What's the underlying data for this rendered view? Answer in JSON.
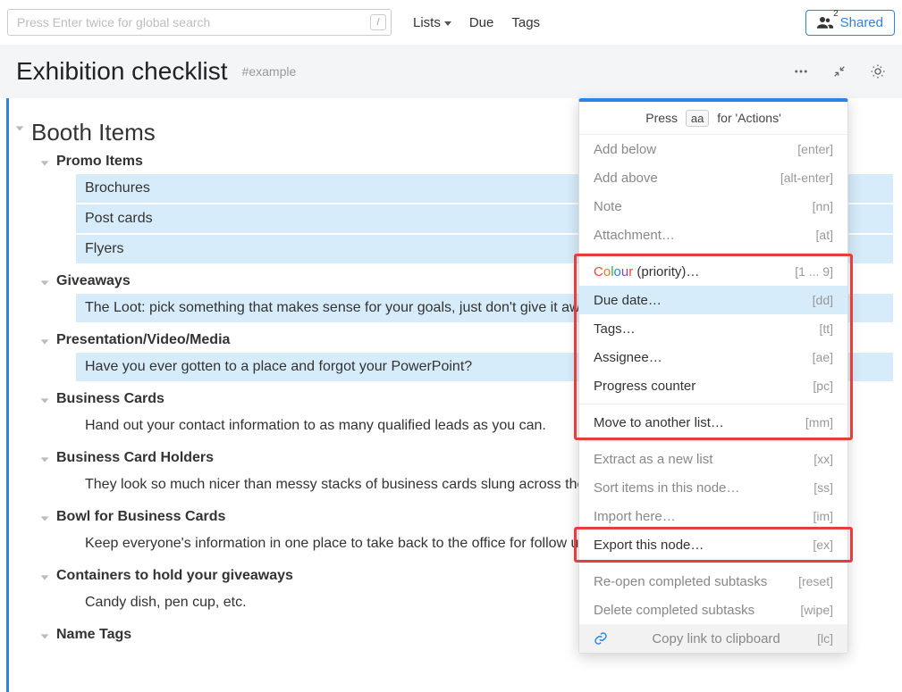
{
  "topbar": {
    "search_placeholder": "Press Enter twice for global search",
    "slash": "/",
    "nav": {
      "lists": "Lists",
      "due": "Due",
      "tags": "Tags"
    },
    "shared": {
      "label": "Shared",
      "count": "2"
    }
  },
  "title": {
    "text": "Exhibition checklist",
    "tag": "#example"
  },
  "outline": {
    "root": "Booth Items",
    "sections": [
      {
        "title": "Promo Items",
        "items": [
          {
            "text": "Brochures",
            "sel": true
          },
          {
            "text": "Post cards",
            "sel": true
          },
          {
            "text": "Flyers",
            "sel": true
          }
        ]
      },
      {
        "title": "Giveaways",
        "items": [
          {
            "text": "The Loot: pick something that makes sense for your goals, just don't give it away for free like candy to trick-or-treaters.",
            "sel": true
          }
        ]
      },
      {
        "title": "Presentation/Video/Media",
        "items": [
          {
            "text": "Have you ever gotten to a place and forgot your PowerPoint?",
            "sel": true
          }
        ]
      },
      {
        "title": "Business Cards",
        "items": [
          {
            "text": "Hand out your contact information to as many qualified leads as you can.",
            "sel": false
          }
        ]
      },
      {
        "title": "Business Card Holders",
        "items": [
          {
            "text": "They look so much nicer than messy stacks of business cards slung across the table.",
            "sel": false
          }
        ]
      },
      {
        "title": "Bowl for Business Cards",
        "items": [
          {
            "text": "Keep everyone's information in one place to take back to the office for follow ups.",
            "sel": false
          }
        ]
      },
      {
        "title": "Containers to hold your giveaways",
        "items": [
          {
            "text": "Candy dish, pen cup, etc.",
            "sel": false
          }
        ]
      },
      {
        "title": "Name Tags",
        "items": []
      }
    ]
  },
  "panel": {
    "hint_pre": "Press",
    "hint_kbd": "aa",
    "hint_post": "for 'Actions'",
    "groups": [
      [
        {
          "label": "Add below",
          "shortcut": "[enter]",
          "enabled": false
        },
        {
          "label": "Add above",
          "shortcut": "[alt-enter]",
          "enabled": false
        },
        {
          "label": "Note",
          "shortcut": "[nn]",
          "enabled": false
        },
        {
          "label": "Attachment…",
          "shortcut": "[at]",
          "enabled": false
        }
      ],
      [
        {
          "label_html": "colour",
          "label": "Colour (priority)…",
          "shortcut": "[1 ... 9]",
          "enabled": true
        },
        {
          "label": "Due date…",
          "shortcut": "[dd]",
          "enabled": true,
          "highlight": true
        },
        {
          "label": "Tags…",
          "shortcut": "[tt]",
          "enabled": true
        },
        {
          "label": "Assignee…",
          "shortcut": "[ae]",
          "enabled": true
        },
        {
          "label": "Progress counter",
          "shortcut": "[pc]",
          "enabled": true
        }
      ],
      [
        {
          "label": "Move to another list…",
          "shortcut": "[mm]",
          "enabled": true
        }
      ],
      [
        {
          "label": "Extract as a new list",
          "shortcut": "[xx]",
          "enabled": false
        },
        {
          "label": "Sort items in this node…",
          "shortcut": "[ss]",
          "enabled": false
        },
        {
          "label": "Import here…",
          "shortcut": "[im]",
          "enabled": false
        },
        {
          "label": "Export this node…",
          "shortcut": "[ex]",
          "enabled": true
        }
      ],
      [
        {
          "label": "Re-open completed subtasks",
          "shortcut": "[reset]",
          "enabled": false
        },
        {
          "label": "Delete completed subtasks",
          "shortcut": "[wipe]",
          "enabled": false
        },
        {
          "label": "Copy link to clipboard",
          "shortcut": "[lc]",
          "enabled": false,
          "copylink": true
        }
      ]
    ]
  }
}
